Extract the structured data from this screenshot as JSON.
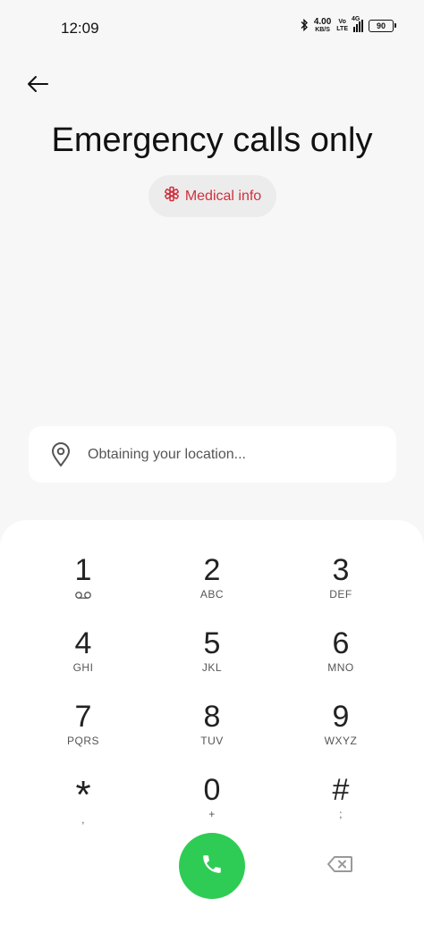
{
  "status": {
    "time": "12:09",
    "speed_value": "4.00",
    "speed_unit": "KB/S",
    "volte_top": "Vo",
    "volte_bottom": "LTE",
    "network": "4G",
    "battery": "90"
  },
  "header": {
    "back_icon": "back-arrow-icon",
    "title": "Emergency calls only",
    "medical_label": "Medical info",
    "medical_icon": "medical-asterisk-icon"
  },
  "location": {
    "icon": "location-pin-icon",
    "text": "Obtaining your location..."
  },
  "dialpad": {
    "keys": [
      {
        "digit": "1",
        "letters": ""
      },
      {
        "digit": "2",
        "letters": "ABC"
      },
      {
        "digit": "3",
        "letters": "DEF"
      },
      {
        "digit": "4",
        "letters": "GHI"
      },
      {
        "digit": "5",
        "letters": "JKL"
      },
      {
        "digit": "6",
        "letters": "MNO"
      },
      {
        "digit": "7",
        "letters": "PQRS"
      },
      {
        "digit": "8",
        "letters": "TUV"
      },
      {
        "digit": "9",
        "letters": "WXYZ"
      },
      {
        "digit": "*",
        "letters": ","
      },
      {
        "digit": "0",
        "letters": "+"
      },
      {
        "digit": "#",
        "letters": ";"
      }
    ],
    "call_icon": "phone-icon",
    "delete_icon": "backspace-icon"
  },
  "colors": {
    "accent_red": "#d0303c",
    "call_green": "#2ecc54"
  }
}
